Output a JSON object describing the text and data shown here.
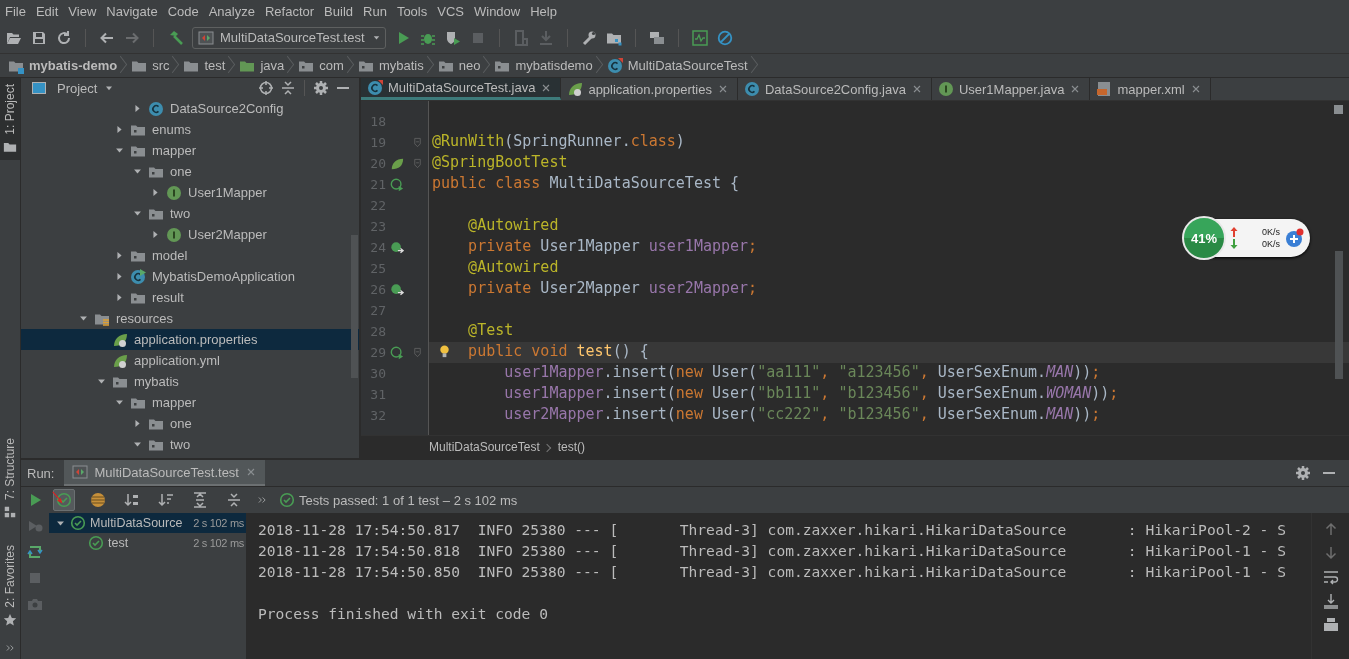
{
  "menu": [
    "File",
    "Edit",
    "View",
    "Navigate",
    "Code",
    "Analyze",
    "Refactor",
    "Build",
    "Run",
    "Tools",
    "VCS",
    "Window",
    "Help"
  ],
  "toolbar": [
    [
      {
        "kind": "open",
        "disabled": false
      },
      {
        "kind": "save",
        "disabled": false
      },
      {
        "kind": "sync",
        "disabled": false
      }
    ],
    [
      {
        "kind": "back",
        "disabled": false
      },
      {
        "kind": "forward",
        "disabled": true
      }
    ],
    [
      {
        "kind": "build",
        "disabled": false
      },
      {
        "kind": "run-config",
        "label": "MultiDataSourceTest.test",
        "disabled": false
      },
      {
        "kind": "run",
        "disabled": false
      },
      {
        "kind": "debug",
        "disabled": false
      },
      {
        "kind": "coverage",
        "disabled": false
      },
      {
        "kind": "stop",
        "disabled": true
      }
    ],
    [
      {
        "kind": "frame",
        "disabled": true
      },
      {
        "kind": "download",
        "disabled": true
      }
    ],
    [
      {
        "kind": "wrench",
        "disabled": false
      },
      {
        "kind": "structure",
        "disabled": false
      }
    ],
    [
      {
        "kind": "stack",
        "disabled": false
      }
    ],
    [
      {
        "kind": "monitor",
        "disabled": false
      },
      {
        "kind": "block",
        "disabled": false
      }
    ]
  ],
  "breadcrumbs": [
    {
      "label": "mybatis-demo",
      "kind": "module"
    },
    {
      "label": "src",
      "kind": "folder"
    },
    {
      "label": "test",
      "kind": "folder"
    },
    {
      "label": "java",
      "kind": "srcfolder"
    },
    {
      "label": "com",
      "kind": "package"
    },
    {
      "label": "mybatis",
      "kind": "package"
    },
    {
      "label": "neo",
      "kind": "package"
    },
    {
      "label": "mybatisdemo",
      "kind": "package"
    },
    {
      "label": "MultiDataSourceTest",
      "kind": "testclass"
    }
  ],
  "tool_window_tabs": {
    "top": [
      {
        "label": "1: Project",
        "kind": "project",
        "selected": true
      }
    ],
    "bottom": [
      {
        "label": "7: Structure",
        "kind": "structure",
        "selected": false
      },
      {
        "label": "2: Favorites",
        "kind": "favorites",
        "selected": false
      }
    ]
  },
  "project_panel": {
    "title": "Project",
    "tree": [
      {
        "children": [
          {
            "children": [
              {
                "children": [
                  {
                    "label": "DataSource2Config",
                    "kind": "class",
                    "expanded": false,
                    "selected": false
                  }
                ]
              },
              {
                "label": "enums",
                "kind": "package",
                "expanded": false,
                "selected": false
              },
              {
                "label": "mapper",
                "kind": "package",
                "expanded": true,
                "selected": false,
                "children": [
                  {
                    "label": "one",
                    "kind": "package",
                    "expanded": true,
                    "selected": false,
                    "children": [
                      {
                        "label": "User1Mapper",
                        "kind": "interface",
                        "expanded": false,
                        "selected": false
                      }
                    ]
                  },
                  {
                    "label": "two",
                    "kind": "package",
                    "expanded": true,
                    "selected": false,
                    "children": [
                      {
                        "label": "User2Mapper",
                        "kind": "interface",
                        "expanded": false,
                        "selected": false
                      }
                    ]
                  }
                ]
              },
              {
                "label": "model",
                "kind": "package",
                "expanded": false,
                "selected": false
              },
              {
                "label": "MybatisDemoApplication",
                "kind": "appclass",
                "expanded": false,
                "selected": false
              },
              {
                "label": "result",
                "kind": "package",
                "expanded": false,
                "selected": false
              }
            ]
          }
        ]
      },
      {
        "label": "resources",
        "kind": "resources",
        "expanded": true,
        "selected": false,
        "children": [
          {
            "label": "application.properties",
            "kind": "leaf",
            "selected": true
          },
          {
            "label": "application.yml",
            "kind": "leaf",
            "selected": false
          },
          {
            "label": "mybatis",
            "kind": "package",
            "expanded": true,
            "selected": false,
            "children": [
              {
                "label": "mapper",
                "kind": "package",
                "expanded": true,
                "selected": false,
                "children": [
                  {
                    "label": "one",
                    "kind": "package",
                    "expanded": false,
                    "selected": false
                  },
                  {
                    "label": "two",
                    "kind": "package",
                    "expanded": true,
                    "selected": false
                  }
                ]
              }
            ]
          }
        ]
      }
    ]
  },
  "editor": {
    "tabs": [
      {
        "label": "MultiDataSourceTest.java",
        "kind": "testclass",
        "selected": true
      },
      {
        "label": "application.properties",
        "kind": "leaf",
        "selected": false
      },
      {
        "label": "DataSource2Config.java",
        "kind": "class",
        "selected": false
      },
      {
        "label": "User1Mapper.java",
        "kind": "interface",
        "selected": false
      },
      {
        "label": "mapper.xml",
        "kind": "xml",
        "selected": false
      }
    ],
    "lines": [
      {
        "number": "18",
        "kind": "plain",
        "fold": false,
        "bulb": false,
        "current": false
      },
      {
        "number": "19",
        "kind": "plain",
        "fold": true,
        "bulb": false,
        "current": false,
        "tokens": [
          {
            "text": "@RunWith",
            "kind": "annotation"
          },
          {
            "text": "(SpringRunner.",
            "kind": "plain"
          },
          {
            "text": "class",
            "kind": "keyword"
          },
          {
            "text": ")",
            "kind": "plain"
          }
        ]
      },
      {
        "number": "20",
        "kind": "spring",
        "fold": true,
        "bulb": false,
        "current": false,
        "tokens": [
          {
            "text": "@SpringBootTest",
            "kind": "annotation"
          }
        ]
      },
      {
        "number": "21",
        "kind": "run",
        "fold": false,
        "bulb": false,
        "current": false,
        "tokens": [
          {
            "text": "public class",
            "kind": "keyword"
          },
          {
            "text": " MultiDataSourceTest {",
            "kind": "plain"
          }
        ]
      },
      {
        "number": "22",
        "kind": "plain",
        "fold": false,
        "bulb": false,
        "current": false
      },
      {
        "number": "23",
        "kind": "plain",
        "fold": false,
        "bulb": false,
        "current": false,
        "tokens": [
          {
            "text": "    @Autowired",
            "kind": "annotation"
          }
        ]
      },
      {
        "number": "24",
        "kind": "bean",
        "fold": false,
        "bulb": false,
        "current": false,
        "tokens": [
          {
            "text": "    private",
            "kind": "keyword"
          },
          {
            "text": " User1Mapper ",
            "kind": "plain"
          },
          {
            "text": "user1Mapper",
            "kind": "field"
          },
          {
            "text": ";",
            "kind": "keyword"
          }
        ]
      },
      {
        "number": "25",
        "kind": "plain",
        "fold": false,
        "bulb": false,
        "current": false,
        "tokens": [
          {
            "text": "    @Autowired",
            "kind": "annotation"
          }
        ]
      },
      {
        "number": "26",
        "kind": "bean",
        "fold": false,
        "bulb": false,
        "current": false,
        "tokens": [
          {
            "text": "    private",
            "kind": "keyword"
          },
          {
            "text": " User2Mapper ",
            "kind": "plain"
          },
          {
            "text": "user2Mapper",
            "kind": "field"
          },
          {
            "text": ";",
            "kind": "keyword"
          }
        ]
      },
      {
        "number": "27",
        "kind": "plain",
        "fold": false,
        "bulb": false,
        "current": false
      },
      {
        "number": "28",
        "kind": "plain",
        "fold": false,
        "bulb": false,
        "current": false,
        "tokens": [
          {
            "text": "    @Test",
            "kind": "annotation"
          }
        ]
      },
      {
        "number": "29",
        "kind": "run",
        "fold": true,
        "bulb": true,
        "current": true,
        "tokens": [
          {
            "text": "    public void",
            "kind": "keyword"
          },
          {
            "text": " test",
            "kind": "method"
          },
          {
            "text": "() {",
            "kind": "plain"
          }
        ]
      },
      {
        "number": "30",
        "kind": "plain",
        "fold": false,
        "bulb": false,
        "current": false,
        "tokens": [
          {
            "text": "        user1Mapper",
            "kind": "field"
          },
          {
            "text": ".insert(",
            "kind": "plain"
          },
          {
            "text": "new",
            "kind": "keyword"
          },
          {
            "text": " User(",
            "kind": "plain"
          },
          {
            "text": "\"aa111\"",
            "kind": "string"
          },
          {
            "text": ", ",
            "kind": "keyword"
          },
          {
            "text": "\"a123456\"",
            "kind": "string"
          },
          {
            "text": ", ",
            "kind": "keyword"
          },
          {
            "text": "UserSexEnum.",
            "kind": "plain"
          },
          {
            "text": "MAN",
            "kind": "static"
          },
          {
            "text": "))",
            "kind": "plain"
          },
          {
            "text": ";",
            "kind": "keyword"
          }
        ]
      },
      {
        "number": "31",
        "kind": "plain",
        "fold": false,
        "bulb": false,
        "current": false,
        "tokens": [
          {
            "text": "        user1Mapper",
            "kind": "field"
          },
          {
            "text": ".insert(",
            "kind": "plain"
          },
          {
            "text": "new",
            "kind": "keyword"
          },
          {
            "text": " User(",
            "kind": "plain"
          },
          {
            "text": "\"bb111\"",
            "kind": "string"
          },
          {
            "text": ", ",
            "kind": "keyword"
          },
          {
            "text": "\"b123456\"",
            "kind": "string"
          },
          {
            "text": ", ",
            "kind": "keyword"
          },
          {
            "text": "UserSexEnum.",
            "kind": "plain"
          },
          {
            "text": "WOMAN",
            "kind": "static"
          },
          {
            "text": "))",
            "kind": "plain"
          },
          {
            "text": ";",
            "kind": "keyword"
          }
        ]
      },
      {
        "number": "32",
        "kind": "plain",
        "fold": false,
        "bulb": false,
        "current": false,
        "tokens": [
          {
            "text": "        user2Mapper",
            "kind": "field"
          },
          {
            "text": ".insert(",
            "kind": "plain"
          },
          {
            "text": "new",
            "kind": "keyword"
          },
          {
            "text": " User(",
            "kind": "plain"
          },
          {
            "text": "\"cc222\"",
            "kind": "string"
          },
          {
            "text": ", ",
            "kind": "keyword"
          },
          {
            "text": "\"b123456\"",
            "kind": "string"
          },
          {
            "text": ", ",
            "kind": "keyword"
          },
          {
            "text": "UserSexEnum.",
            "kind": "plain"
          },
          {
            "text": "MAN",
            "kind": "static"
          },
          {
            "text": "))",
            "kind": "plain"
          },
          {
            "text": ";",
            "kind": "keyword"
          }
        ]
      }
    ],
    "breadcrumbs": [
      "MultiDataSourceTest",
      "test()"
    ]
  },
  "network_widget": {
    "percent": "41%",
    "upload": "0K/s",
    "download": "0K/s"
  },
  "run_panel": {
    "label": "Run:",
    "tab": {
      "label": "MultiDataSourceTest.test",
      "selected": true
    },
    "side_tools": [
      {
        "kind": "run",
        "disabled": false
      },
      {
        "kind": "rerun",
        "disabled": true
      },
      {
        "kind": "autotest",
        "disabled": false
      },
      {
        "kind": "stop",
        "disabled": true
      },
      {
        "kind": "camera",
        "disabled": true
      }
    ],
    "tools": [
      {
        "kind": "check",
        "on": true
      },
      {
        "kind": "striped",
        "on": false
      },
      {
        "kind": "sortalpha",
        "on": false
      },
      {
        "kind": "sortdur",
        "on": false
      },
      {
        "kind": "expandall",
        "on": false
      },
      {
        "kind": "collapseall",
        "on": false
      }
    ],
    "status": "Tests passed: 1 of 1 test – 2 s 102 ms",
    "tests": [
      {
        "label": "MultiDataSource",
        "time": "2 s 102 ms",
        "passed": true,
        "selected": true,
        "expanded": true,
        "children": [
          {
            "label": "test",
            "time": "2 s 102 ms",
            "passed": true,
            "selected": false
          }
        ]
      }
    ],
    "console": {
      "lines": [
        "2018-11-28 17:54:50.817  INFO 25380 --- [       Thread-3] com.zaxxer.hikari.HikariDataSource       : HikariPool-2 - S",
        "2018-11-28 17:54:50.818  INFO 25380 --- [       Thread-3] com.zaxxer.hikari.HikariDataSource       : HikariPool-1 - S",
        "2018-11-28 17:54:50.850  INFO 25380 --- [       Thread-3] com.zaxxer.hikari.HikariDataSource       : HikariPool-1 - S"
      ],
      "exit_message": "Process finished with exit code 0"
    }
  }
}
